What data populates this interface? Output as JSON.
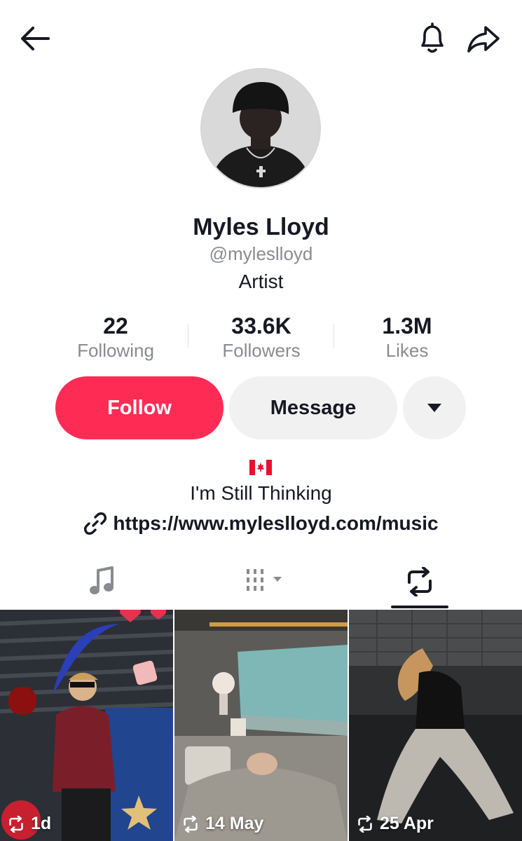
{
  "header": {
    "back_icon": "back-arrow-icon",
    "bell_icon": "bell-icon",
    "share_icon": "share-arrow-icon"
  },
  "profile": {
    "name": "Myles Lloyd",
    "handle": "@myleslloyd",
    "role": "Artist",
    "flag_icon": "canada-flag-icon",
    "bio": "I'm Still Thinking",
    "link": "https://www.myleslloyd.com/music"
  },
  "stats": [
    {
      "value": "22",
      "label": "Following"
    },
    {
      "value": "33.6K",
      "label": "Followers"
    },
    {
      "value": "1.3M",
      "label": "Likes"
    }
  ],
  "actions": {
    "follow_label": "Follow",
    "message_label": "Message",
    "more_icon": "caret-down-icon"
  },
  "tabs": [
    {
      "icon": "music-note-icon"
    },
    {
      "icon": "grid-dropdown-icon"
    },
    {
      "icon": "repost-icon",
      "active": true
    }
  ],
  "grid": [
    {
      "time": "1d"
    },
    {
      "time": "14 May"
    },
    {
      "time": "25 Apr"
    }
  ],
  "colors": {
    "accent": "#fe2c55",
    "button_grey": "#f1f1f2",
    "text_primary": "#161823",
    "text_secondary": "#8a8b91"
  }
}
